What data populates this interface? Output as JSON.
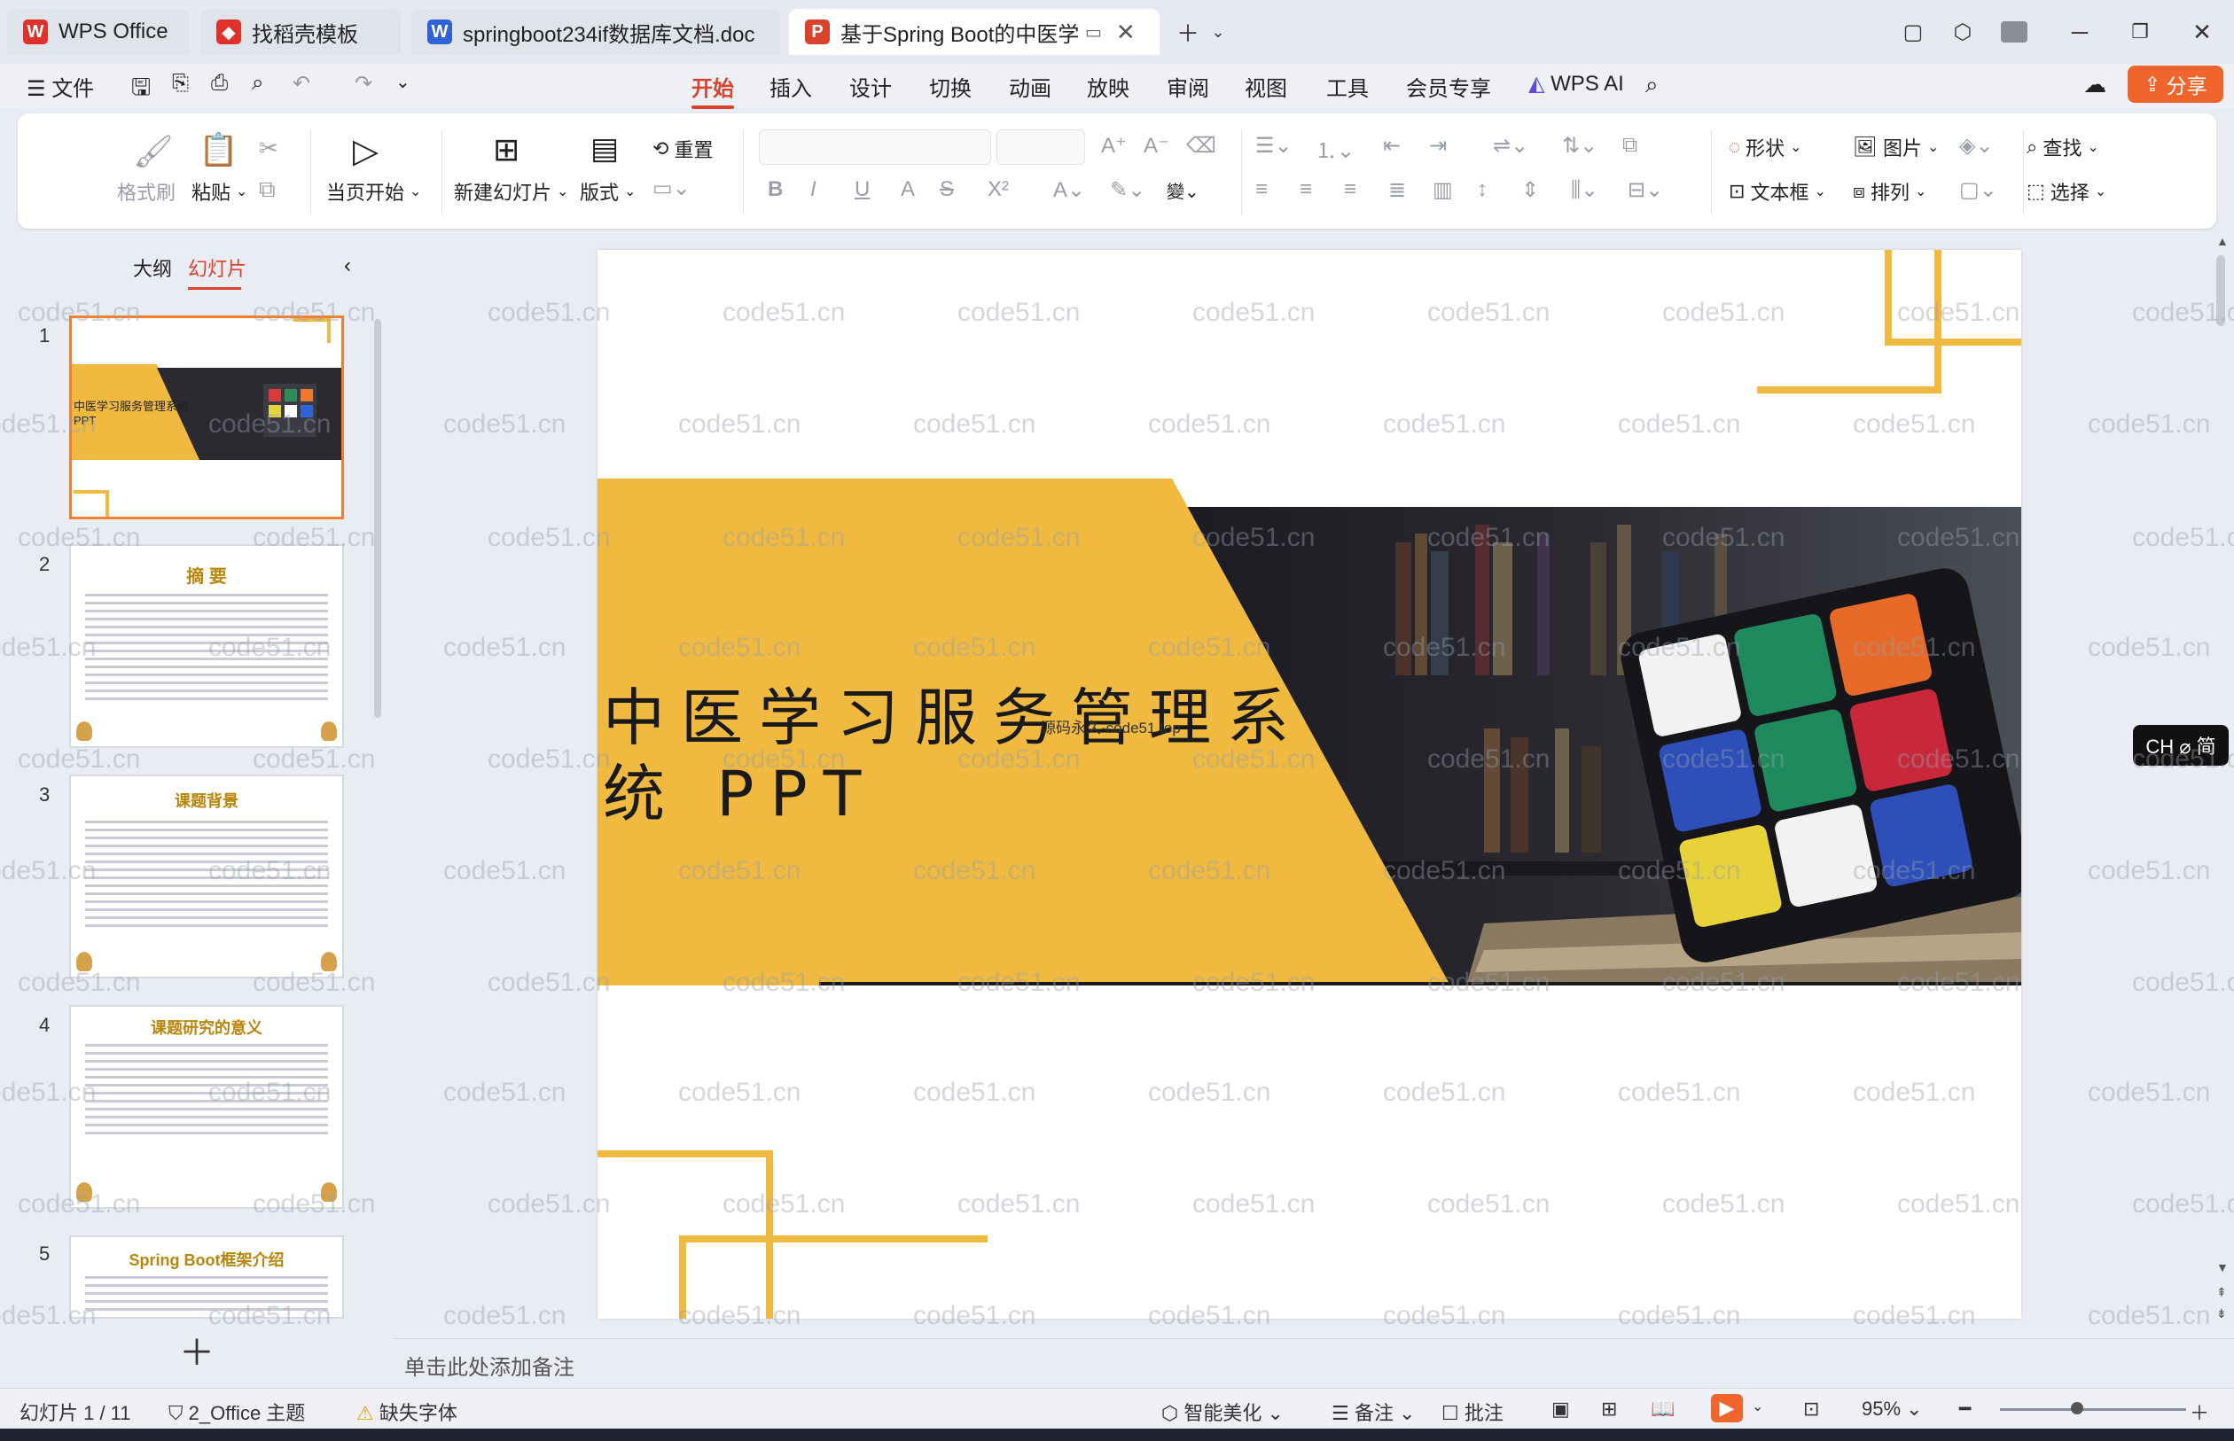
{
  "tabs": [
    {
      "label": "WPS Office",
      "badge": "W",
      "color": "#e0312b"
    },
    {
      "label": "找稻壳模板",
      "badge": "D",
      "color": "#e0312b"
    },
    {
      "label": "springboot234if数据库文档.doc",
      "badge": "W",
      "color": "#2f62d9"
    },
    {
      "label": "基于Spring Boot的中医学习",
      "badge": "P",
      "color": "#d9432c"
    }
  ],
  "menu": {
    "file": "文件",
    "items": [
      "开始",
      "插入",
      "设计",
      "切换",
      "动画",
      "放映",
      "审阅",
      "视图",
      "工具",
      "会员专享"
    ],
    "ai": "WPS AI",
    "share": "分享"
  },
  "ribbon": {
    "format_painter": "格式刷",
    "paste": "粘贴",
    "play_current": "当页开始",
    "new_slide": "新建幻灯片",
    "layout": "版式",
    "reset": "重置",
    "shape": "形状",
    "picture": "图片",
    "find": "查找",
    "textbox": "文本框",
    "arrange": "排列",
    "select": "选择"
  },
  "left_panel": {
    "outline_tab": "大纲",
    "slides_tab": "幻灯片",
    "thumbnails": [
      {
        "num": "1",
        "title": "中医学习服务管理系统 PPT"
      },
      {
        "num": "2",
        "title": "摘  要"
      },
      {
        "num": "3",
        "title": "课题背景"
      },
      {
        "num": "4",
        "title": "课题研究的意义"
      },
      {
        "num": "5",
        "title": "Spring Boot框架介绍"
      }
    ]
  },
  "slide": {
    "title_line1": "中医学习服务管理系",
    "title_line2": "统 PPT",
    "overlay_text": "源码永久-code51.top",
    "accent_color": "#f0b93f"
  },
  "notes_placeholder": "单击此处添加备注",
  "watermark_text": "code51.cn",
  "ime": "CH ⌀ 简",
  "status": {
    "slide_counter": "幻灯片 1 / 11",
    "theme": "2_Office 主题",
    "missing_font": "缺失字体",
    "beautify": "智能美化",
    "notes": "备注",
    "comments": "批注",
    "zoom": "95%"
  }
}
